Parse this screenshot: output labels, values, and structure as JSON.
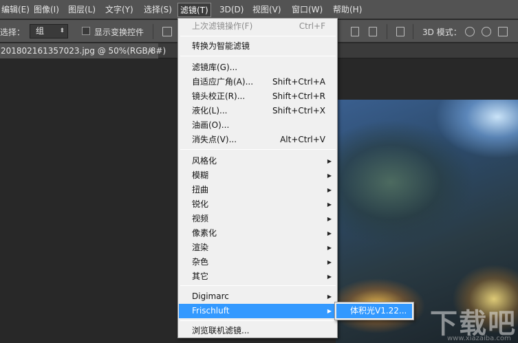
{
  "menubar": {
    "items": [
      {
        "label": "编辑(E)"
      },
      {
        "label": "图像(I)"
      },
      {
        "label": "图层(L)"
      },
      {
        "label": "文字(Y)"
      },
      {
        "label": "选择(S)"
      },
      {
        "label": "滤镜(T)",
        "active": true
      },
      {
        "label": "3D(D)"
      },
      {
        "label": "视图(V)"
      },
      {
        "label": "窗口(W)"
      },
      {
        "label": "帮助(H)"
      }
    ]
  },
  "options": {
    "select_label": "选择：",
    "select_value": "组",
    "transform_label": "显示变换控件",
    "mode_3d_label": "3D 模式："
  },
  "document": {
    "tab_title": "201802161357023.jpg @ 50%(RGB/8#)",
    "close_glyph": "×"
  },
  "filter_menu": {
    "last_filter": {
      "label": "上次滤镜操作(F)",
      "shortcut": "Ctrl+F"
    },
    "smart_filter": {
      "label": "转换为智能滤镜"
    },
    "gallery": {
      "label": "滤镜库(G)..."
    },
    "adaptive_wide": {
      "label": "自适应广角(A)...",
      "shortcut": "Shift+Ctrl+A"
    },
    "lens_correction": {
      "label": "镜头校正(R)...",
      "shortcut": "Shift+Ctrl+R"
    },
    "liquify": {
      "label": "液化(L)...",
      "shortcut": "Shift+Ctrl+X"
    },
    "oil_paint": {
      "label": "油画(O)..."
    },
    "vanishing_point": {
      "label": "消失点(V)...",
      "shortcut": "Alt+Ctrl+V"
    },
    "submenus": [
      {
        "label": "风格化"
      },
      {
        "label": "模糊"
      },
      {
        "label": "扭曲"
      },
      {
        "label": "锐化"
      },
      {
        "label": "视频"
      },
      {
        "label": "像素化"
      },
      {
        "label": "渲染"
      },
      {
        "label": "杂色"
      },
      {
        "label": "其它"
      }
    ],
    "digimarc": {
      "label": "Digimarc"
    },
    "frischluft": {
      "label": "Frischluft"
    },
    "browse_online": {
      "label": "浏览联机滤镜..."
    },
    "submenu_arrow": "▶"
  },
  "frischluft_submenu": {
    "items": [
      {
        "label": "体积光V1.22..."
      }
    ]
  },
  "watermark": {
    "text": "下载吧",
    "sub": "www.xiazaiba.com"
  },
  "colors": {
    "menu_highlight": "#3399ff",
    "menubar_bg": "#535353",
    "workspace_bg": "#282828"
  }
}
